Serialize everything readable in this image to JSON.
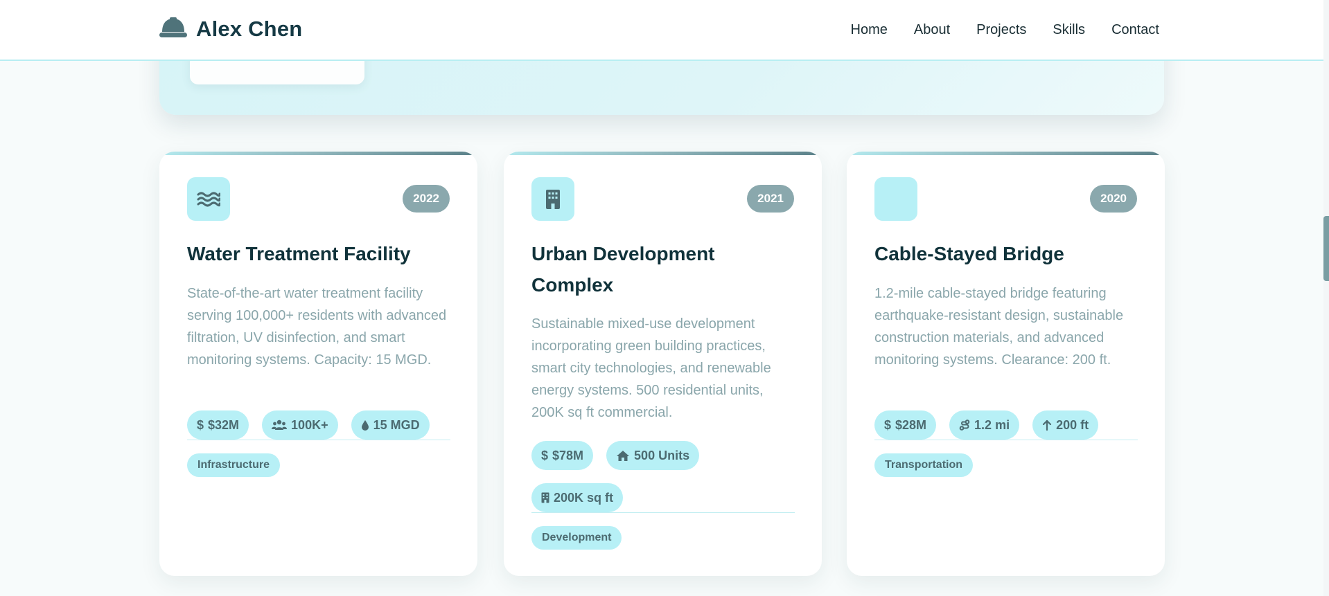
{
  "header": {
    "brand_icon": "hard-hat-icon",
    "brand_name": "Alex Chen",
    "nav": [
      "Home",
      "About",
      "Projects",
      "Skills",
      "Contact"
    ]
  },
  "projects": [
    {
      "icon": "water-waves-icon",
      "year": "2022",
      "title": "Water Treatment Facility",
      "description": "State-of-the-art water treatment facility serving 100,000+ residents with advanced filtration, UV disinfection, and smart monitoring systems. Capacity: 15 MGD.",
      "stats": [
        {
          "icon": "dollar-icon",
          "text": "$32M"
        },
        {
          "icon": "users-icon",
          "text": "100K+"
        },
        {
          "icon": "water-drop-icon",
          "text": "15 MGD"
        }
      ],
      "tag": "Infrastructure"
    },
    {
      "icon": "building-icon",
      "year": "2021",
      "title": "Urban Development Complex",
      "description": "Sustainable mixed-use development incorporating green building practices, smart city technologies, and renewable energy systems. 500 residential units, 200K sq ft commercial.",
      "stats": [
        {
          "icon": "dollar-icon",
          "text": "$78M"
        },
        {
          "icon": "home-icon",
          "text": "500 Units"
        },
        {
          "icon": "building-icon",
          "text": "200K sq ft"
        }
      ],
      "tag": "Development"
    },
    {
      "icon": "bridge-icon",
      "year": "2020",
      "title": "Cable-Stayed Bridge",
      "description": "1.2-mile cable-stayed bridge featuring earthquake-resistant design, sustainable construction materials, and advanced monitoring systems. Clearance: 200 ft.",
      "stats": [
        {
          "icon": "dollar-icon",
          "text": "$28M"
        },
        {
          "icon": "route-icon",
          "text": "1.2 mi"
        },
        {
          "icon": "arrow-up-icon",
          "text": "200 ft"
        }
      ],
      "tag": "Transportation"
    }
  ],
  "colors": {
    "accent": "#b7f0f6",
    "badge": "#8aa8ad",
    "title": "#10323a",
    "muted_text": "#8aa6ab"
  }
}
